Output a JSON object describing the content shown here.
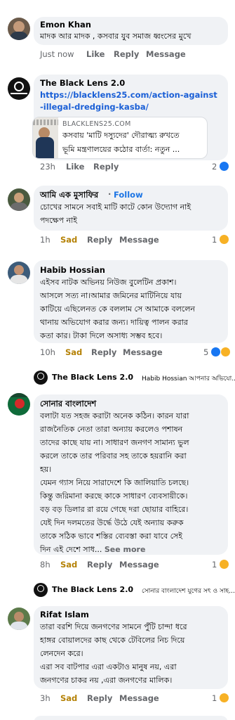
{
  "comments": [
    {
      "author": "Emon Khan",
      "lines": [
        "মাদক আর মাদক , কসবার যুব সমাজ ধ্বংসের মুখে"
      ],
      "time": "Just now",
      "like": "Like",
      "reply": "Reply",
      "message": "Message"
    },
    {
      "author": "The Black Lens 2.0",
      "link_lines": [
        "https://blacklens25.com/action-against",
        "-illegal-dredging-kasba/"
      ],
      "preview_domain": "BLACKLENS25.COM",
      "preview_lines": [
        "কসবায় 'মাটি দস্যুদের' দৌরাত্ম্য রুখতে",
        "ভূমি মন্ত্রণালয়ের কঠোর বার্তা: নতুন ..."
      ],
      "time": "23h",
      "like": "Like",
      "reply": "Reply",
      "reaction_count": "2"
    },
    {
      "author": "আমি এক মুসাফির",
      "separator": "·",
      "follow": "Follow",
      "lines": [
        "চোখের সামনে সবাই মাটি কাটে কোন উদ্যোগ নাই",
        "পদক্ষেপ নাই"
      ],
      "time": "1h",
      "reaction_label": "Sad",
      "reply": "Reply",
      "message": "Message",
      "reaction_count": "1"
    },
    {
      "author": "Habib Hossian",
      "lines": [
        "এইসব নাটক অভিনয় নিউজ বুলেটিন প্রকাশ।",
        "আসলে সত্য না।আমার জমিনের মাটিনিয়ে যায়",
        "কাটিয়ে এছিলেনত কে বললাম সে আমাকে বললেন",
        "থানায় অভিযোগ করার জন্য। দায়িত্ব পালন করার",
        "কতা কার। টাকা দিলে অসাধ্য সম্ভব হবে।"
      ],
      "time": "10h",
      "reaction_label": "Sad",
      "reply": "Reply",
      "message": "Message",
      "reaction_count": "5"
    },
    {
      "reply_author": "The Black Lens 2.0",
      "reply_preview": "Habib Hossian আপনার অভিযো..."
    },
    {
      "author": "সোনার বাংলাদেশ",
      "lines": [
        "বলাটা যত সহজ করাটা অনেক কঠিন। কারন যারা",
        "রাজনৈতিক নেতা তারা অন্যায় করলেও পশাষন",
        "তাদের কাছে যায় না। সাধারণ জনগণ সামান্য ভুল",
        "করলে তাকে তার পরিবার সহ তাকে হয়রানি করা",
        "হয়।",
        "যেমন গ্যাস নিয়ে সারাদেশে কি জালিয়াতি চলছে।",
        "কিন্তু জরিমানা করছে কাকে সাধারণ ব্যেবসায়ীকে।",
        "বড় বড় ডিলার রা রয়ে গেছে দরা ছোয়ার বাহিরে।",
        "যেই দিন দলমতের উর্দ্ধে উঠে যেই অন্যায় করুক",
        "তাকে সঠিক ভাবে শস্তির ব্যেবস্তা করা যাবে সেই"
      ],
      "last_line": "দিন এই দেশে সাধ...",
      "see_more": "See more",
      "time": "8h",
      "reaction_label": "Sad",
      "reply": "Reply",
      "message": "Message",
      "reaction_count": "1"
    },
    {
      "reply_author": "The Black Lens 2.0",
      "reply_preview": "সোনার বাংলাদেশ যুগের সৎ ও সাহ..."
    },
    {
      "author": "Rifat Islam",
      "lines": [
        "তারা বরশি দিয়ে জনগণের সামনে পুঁটি চান্দা ধরে",
        "হাঙ্গর বোয়ালদের কাছ থেকে টেবিলের নিচ দিয়ে",
        "লেনদেন করে।",
        "এরা সব বাটপার এরা একটাও মানুষ নয়, এরা",
        "জনগণের চাকর নয় ,এরা জনগণের মালিক।"
      ],
      "time": "3h",
      "reaction_label": "Sad",
      "reply": "Reply",
      "message": "Message",
      "reaction_count": "1"
    }
  ],
  "colors": {
    "bubble": "#f0f2f5",
    "meta": "#65676b",
    "sad": "#b58207",
    "link": "#1a5fd6",
    "like_blue": "#1877f2",
    "sad_yellow": "#f7b125"
  },
  "icons": [
    "avatar-photo",
    "blacklens-logo-icon",
    "like-reaction-icon",
    "sad-reaction-icon"
  ]
}
